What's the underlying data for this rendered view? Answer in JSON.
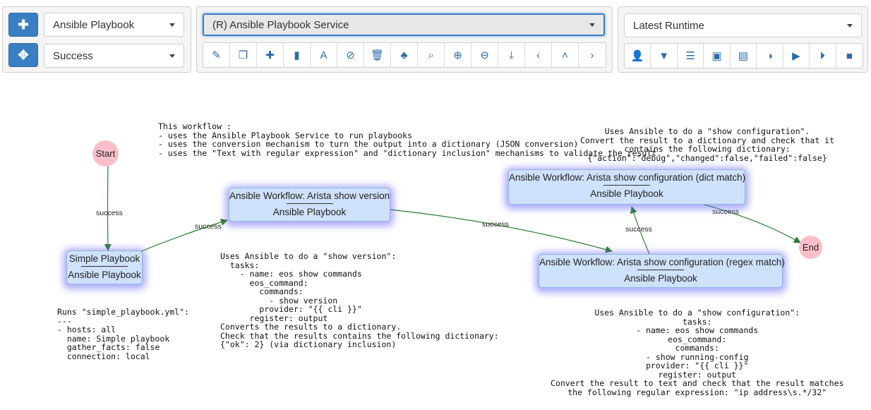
{
  "toolbar_left": {
    "add_icon": "plus-icon",
    "move_icon": "move-arrows-icon",
    "service_type_select": "Ansible Playbook",
    "edge_type_select": "Success"
  },
  "toolbar_center": {
    "workflow_select": "(R) Ansible Playbook Service",
    "buttons": [
      {
        "name": "edit-workflow",
        "icon": "edit-icon",
        "glyph": "✎"
      },
      {
        "name": "duplicate-workflow",
        "icon": "copy-icon",
        "glyph": "❐"
      },
      {
        "name": "add-service",
        "icon": "plus-icon",
        "glyph": "✚"
      },
      {
        "name": "add-label",
        "icon": "book-icon",
        "glyph": "▮"
      },
      {
        "name": "text",
        "icon": "font-icon",
        "glyph": "A"
      },
      {
        "name": "stop",
        "icon": "ban-icon",
        "glyph": "⊘"
      },
      {
        "name": "delete",
        "icon": "trash-icon",
        "glyph": "🗑"
      },
      {
        "name": "tree",
        "icon": "tree-icon",
        "glyph": "♣"
      },
      {
        "name": "search",
        "icon": "search-icon",
        "glyph": "⌕"
      },
      {
        "name": "zoom-in",
        "icon": "zoom-in-icon",
        "glyph": "⊕"
      },
      {
        "name": "zoom-out",
        "icon": "zoom-out-icon",
        "glyph": "⊖"
      },
      {
        "name": "export",
        "icon": "export-icon",
        "glyph": "⤓"
      },
      {
        "name": "back",
        "icon": "chevron-left-icon",
        "glyph": "‹"
      },
      {
        "name": "up",
        "icon": "chevron-up-icon",
        "glyph": "˄"
      },
      {
        "name": "forward",
        "icon": "chevron-right-icon",
        "glyph": "›"
      }
    ]
  },
  "toolbar_right": {
    "runtime_select": "Latest Runtime",
    "buttons": [
      {
        "name": "user",
        "icon": "user-icon",
        "glyph": "👤"
      },
      {
        "name": "filter",
        "icon": "filter-icon",
        "glyph": "▼"
      },
      {
        "name": "list",
        "icon": "list-icon",
        "glyph": "☰"
      },
      {
        "name": "save",
        "icon": "save-icon",
        "glyph": "▣"
      },
      {
        "name": "logs",
        "icon": "logs-icon",
        "glyph": "▤"
      },
      {
        "name": "contrast",
        "icon": "contrast-icon",
        "glyph": "◑"
      },
      {
        "name": "run",
        "icon": "play-icon",
        "glyph": "▶"
      },
      {
        "name": "run-step",
        "icon": "play-circle-icon",
        "glyph": "⏵"
      },
      {
        "name": "stop",
        "icon": "stop-icon",
        "glyph": "■"
      }
    ]
  },
  "colors": {
    "accent": "#3a7fc1",
    "node_fill": "#cfe2fb",
    "node_glow": "#6e6ef5",
    "terminal_fill": "#f8bfca",
    "edge": "#2e7d32"
  },
  "canvas": {
    "intro_note": "This workflow :\n- uses the Ansible Playbook Service to run playbooks\n- uses the conversion mechanism to turn the output into a dictionary (JSON conversion)\n- uses the \"Text with regular expression\" and \"dictionary inclusion\" mechanisms to validate the result.",
    "start_label": "Start",
    "end_label": "End",
    "nodes": {
      "simple": {
        "title": "Simple Playbook",
        "subtitle": "Ansible Playbook"
      },
      "version": {
        "title": "Ansible Workflow: Arista show version",
        "subtitle": "Ansible Playbook"
      },
      "dict_match": {
        "title": "Ansible Workflow: Arista show configuration (dict match)",
        "subtitle": "Ansible Playbook"
      },
      "regex_match": {
        "title": "Ansible Workflow: Arista show configuration (regex match)",
        "subtitle": "Ansible Playbook"
      }
    },
    "edge_label": "success",
    "note_simple": "Runs \"simple_playbook.yml\":\n---\n- hosts: all\n  name: Simple playbook\n  gather_facts: false\n  connection: local",
    "note_version": "Uses Ansible to do a \"show version\":\n  tasks:\n    - name: eos show commands\n      eos_command:\n        commands:\n          - show version\n        provider: \"{{ cli }}\"\n      register: output\nConverts the results to a dictionary.\nCheck that the results contains the following dictionary:\n{\"ok\": 2} (via dictionary inclusion)",
    "note_dict": "Uses Ansible to do a \"show configuration\".\nConvert the result to a dictionary and check that it\ncontains the following dictionary:\n{\"action\":\"debug\",\"changed\":false,\"failed\":false}",
    "note_regex": "Uses Ansible to do a \"show configuration\":\ntasks:\n- name: eos show commands\neos_command:\ncommands:\n- show running-config\nprovider: \"{{ cli }}\"\nregister: output\nConvert the result to text and check that the result matches\nthe following regular expression: \"ip address\\s.*/32\""
  }
}
